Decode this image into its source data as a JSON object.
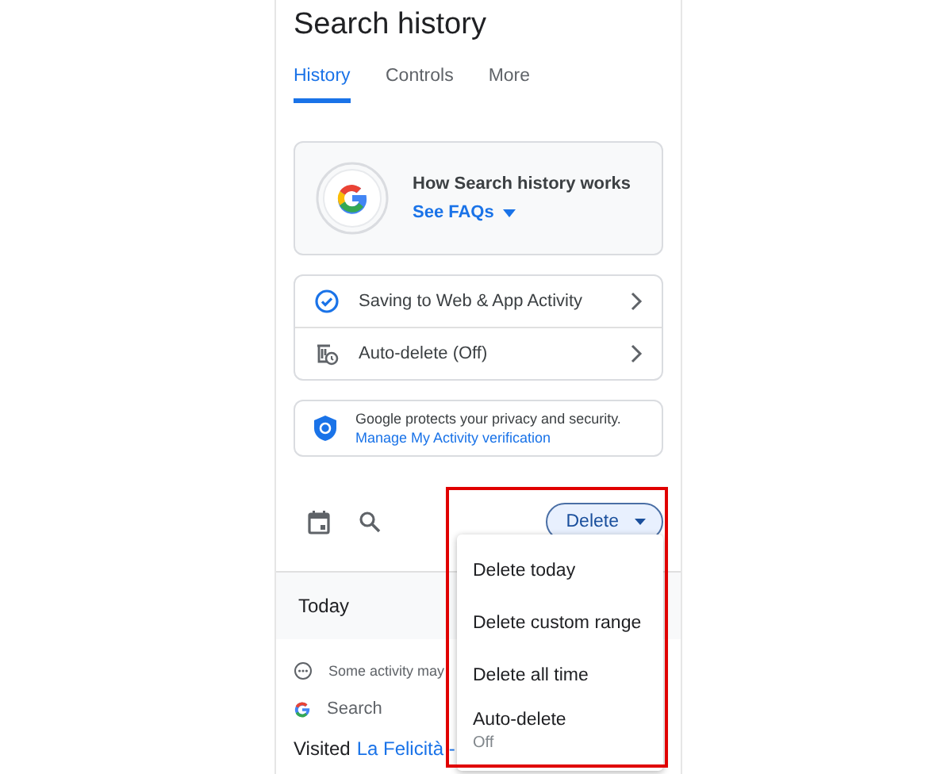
{
  "title": "Search history",
  "tabs": [
    {
      "label": "History",
      "selected": true
    },
    {
      "label": "Controls",
      "selected": false
    },
    {
      "label": "More",
      "selected": false
    }
  ],
  "info_card": {
    "title": "How Search history works",
    "link": "See FAQs"
  },
  "settings": [
    {
      "kind": "check",
      "label": "Saving to Web & App Activity"
    },
    {
      "kind": "autodelete",
      "label": "Auto-delete (Off)"
    }
  ],
  "security": {
    "text": "Google protects your privacy and security.",
    "link": "Manage My Activity verification"
  },
  "delete_button": "Delete",
  "section": "Today",
  "notice": "Some activity may",
  "product": "Search",
  "visited": {
    "prefix": "Visited",
    "link": "La Felicità -"
  },
  "menu": [
    {
      "label": "Delete today"
    },
    {
      "label": "Delete custom range"
    },
    {
      "label": "Delete all time"
    },
    {
      "label": "Auto-delete",
      "sub": "Off"
    }
  ]
}
